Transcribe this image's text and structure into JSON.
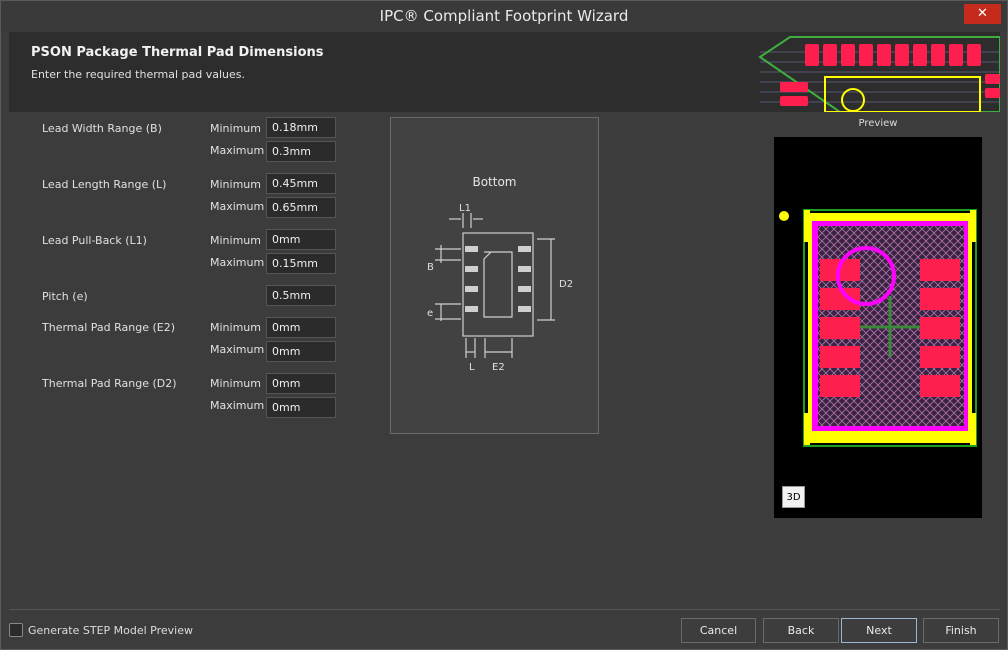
{
  "window": {
    "title": "IPC® Compliant Footprint Wizard",
    "close_glyph": "✕"
  },
  "header": {
    "title": "PSON Package Thermal Pad Dimensions",
    "subtitle": "Enter the required thermal pad values."
  },
  "form": {
    "lead_width": {
      "label": "Lead Width Range (B)",
      "min_label": "Minimum",
      "max_label": "Maximum",
      "min": "0.18mm",
      "max": "0.3mm"
    },
    "lead_length": {
      "label": "Lead Length Range (L)",
      "min_label": "Minimum",
      "max_label": "Maximum",
      "min": "0.45mm",
      "max": "0.65mm"
    },
    "lead_pullback": {
      "label": "Lead Pull-Back (L1)",
      "min_label": "Minimum",
      "max_label": "Maximum",
      "min": "0mm",
      "max": "0.15mm"
    },
    "pitch": {
      "label": "Pitch (e)",
      "value": "0.5mm"
    },
    "thermal_e2": {
      "label": "Thermal Pad Range (E2)",
      "min_label": "Minimum",
      "max_label": "Maximum",
      "min": "0mm",
      "max": "0mm"
    },
    "thermal_d2": {
      "label": "Thermal Pad Range (D2)",
      "min_label": "Minimum",
      "max_label": "Maximum",
      "min": "0mm",
      "max": "0mm"
    }
  },
  "diagram": {
    "view_label": "Bottom",
    "dims": {
      "l1": "L1",
      "b": "B",
      "e": "e",
      "d2": "D2",
      "l": "L",
      "e2": "E2"
    }
  },
  "preview": {
    "title": "Preview",
    "btn_3d": "3D"
  },
  "colors": {
    "pad": "#ff1f4f",
    "silkscreen": "#ffff00",
    "courtyard": "#ff00ff",
    "outline": "#00aa00"
  },
  "footer": {
    "step_preview_label": "Generate STEP Model Preview",
    "step_preview_checked": false,
    "cancel": "Cancel",
    "back": "Back",
    "next": "Next",
    "finish": "Finish"
  }
}
